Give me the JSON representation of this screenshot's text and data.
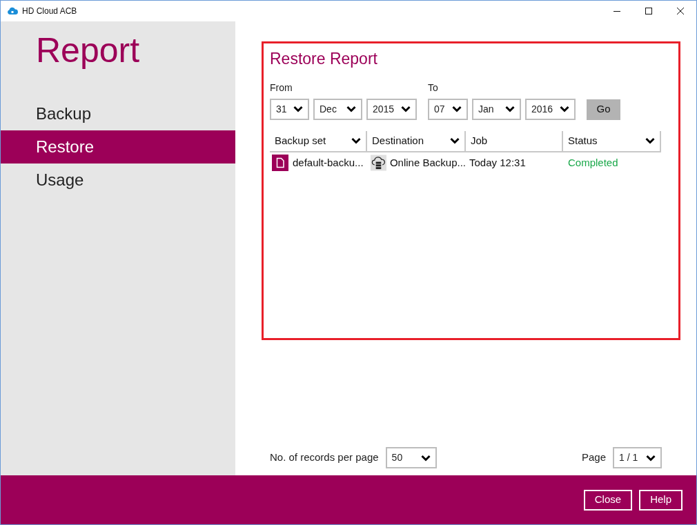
{
  "window": {
    "title": "HD Cloud ACB"
  },
  "sidebar": {
    "heading": "Report",
    "items": [
      {
        "label": "Backup",
        "selected": false
      },
      {
        "label": "Restore",
        "selected": true
      },
      {
        "label": "Usage",
        "selected": false
      }
    ]
  },
  "report": {
    "title": "Restore Report",
    "from": {
      "label": "From",
      "day": "31",
      "month": "Dec",
      "year": "2015"
    },
    "to": {
      "label": "To",
      "day": "07",
      "month": "Jan",
      "year": "2016"
    },
    "go_button": "Go",
    "table": {
      "columns": [
        {
          "label": "Backup set",
          "menu": true
        },
        {
          "label": "Destination",
          "menu": true
        },
        {
          "label": "Job",
          "menu": false
        },
        {
          "label": "Status",
          "menu": true
        }
      ],
      "rows": [
        {
          "backup_set": "default-backu...",
          "destination": "Online Backup...",
          "job": "Today 12:31",
          "status": "Completed"
        }
      ]
    }
  },
  "pagination": {
    "records_label": "No. of records per page",
    "records": "50",
    "page_label": "Page",
    "page": "1 / 1"
  },
  "footer": {
    "buttons": [
      "Close",
      "Help"
    ]
  }
}
